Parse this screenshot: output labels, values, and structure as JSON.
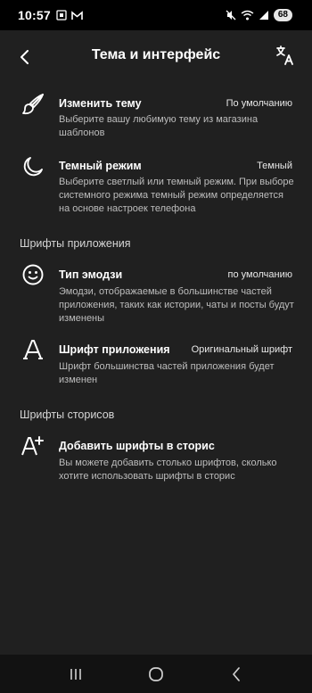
{
  "status": {
    "time": "10:57",
    "battery": "68"
  },
  "header": {
    "title": "Тема и интерфейс"
  },
  "items": [
    {
      "label": "Изменить тему",
      "value": "По умолчанию",
      "description": "Выберите вашу любимую тему из магазина шаблонов",
      "icon": "brush-icon"
    },
    {
      "label": "Темный режим",
      "value": "Темный",
      "description": "Выберите светлый или темный режим. При выборе системного режима темный режим определяется на основе настроек телефона",
      "icon": "moon-icon"
    }
  ],
  "sections": {
    "fonts": "Шрифты приложения",
    "stories": "Шрифты сторисов"
  },
  "font_items": [
    {
      "label": "Тип эмодзи",
      "value": "по умолчанию",
      "description": "Эмодзи, отображаемые в большинстве частей приложения, таких как истории, чаты и посты будут изменены",
      "icon": "smile-icon"
    },
    {
      "label": "Шрифт приложения",
      "value": "Оригинальный шрифт",
      "description": "Шрифт большинства частей приложения будет изменен",
      "icon": "font-icon"
    }
  ],
  "story_items": [
    {
      "label": "Добавить шрифты в сторис",
      "description": "Вы можете добавить столько шрифтов, сколько хотите использовать шрифты в сторис",
      "icon": "add-font-icon"
    }
  ]
}
